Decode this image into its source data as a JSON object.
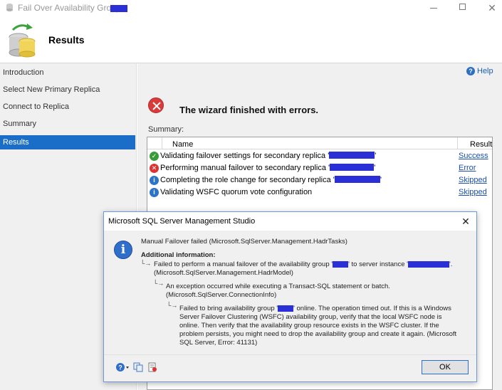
{
  "window": {
    "title": "Fail Over Availability Group:",
    "minimize_icon": "minimize-icon",
    "maximize_icon": "maximize-icon",
    "close_glyph": "✕"
  },
  "header": {
    "title": "Results",
    "icon": "database-failover-icon"
  },
  "nav": {
    "items": [
      {
        "label": "Introduction"
      },
      {
        "label": "Select New Primary Replica"
      },
      {
        "label": "Connect to Replica"
      },
      {
        "label": "Summary"
      },
      {
        "label": "Results"
      }
    ],
    "active_index": 4
  },
  "main": {
    "help_label": "Help",
    "status_message": "The wizard finished with errors.",
    "summary_label": "Summary:",
    "columns": {
      "name": "Name",
      "result": "Result"
    },
    "rows": [
      {
        "status": "success",
        "text": "Validating failover settings for secondary replica '",
        "suffix": "'",
        "result": "Success"
      },
      {
        "status": "error",
        "text": "Performing manual failover to secondary replica '",
        "suffix": "'",
        "result": "Error"
      },
      {
        "status": "info",
        "text": "Completing the role change for secondary replica '",
        "suffix": "'",
        "result": "Skipped"
      },
      {
        "status": "info",
        "text": "Validating WSFC quorum vote configuration",
        "suffix": "",
        "result": "Skipped"
      }
    ]
  },
  "dialog": {
    "title": "Microsoft SQL Server Management Studio",
    "close_glyph": "✕",
    "icon": "info-icon",
    "line1": "Manual Failover failed (Microsoft.SqlServer.Management.HadrTasks)",
    "additional_info": "Additional information:",
    "err1_a": "Failed to perform a manual failover of the availability group '",
    "err1_b": "' to server instance '",
    "err1_c": "'.",
    "err1_d": "(Microsoft.SqlServer.Management.HadrModel)",
    "err2_a": "An exception occurred while executing a Transact-SQL statement or batch.",
    "err2_b": "(Microsoft.SqlServer.ConnectionInfo)",
    "err3_a1": "Failed to bring availability group '",
    "err3_a2": "' online.  The operation timed out. If this is a Windows",
    "err3_b": "Server Failover Clustering (WSFC) availability group, verify that the local WSFC node is",
    "err3_c": "online. Then verify that the availability group resource exists in the WSFC cluster. If the",
    "err3_d": "problem persists, you might need to drop the availability group and create it again. (Microsoft",
    "err3_e": "SQL Server, Error: 41131)",
    "ok_label": "OK",
    "tools": [
      "help-dropdown-icon",
      "copy-icon",
      "details-icon"
    ]
  }
}
